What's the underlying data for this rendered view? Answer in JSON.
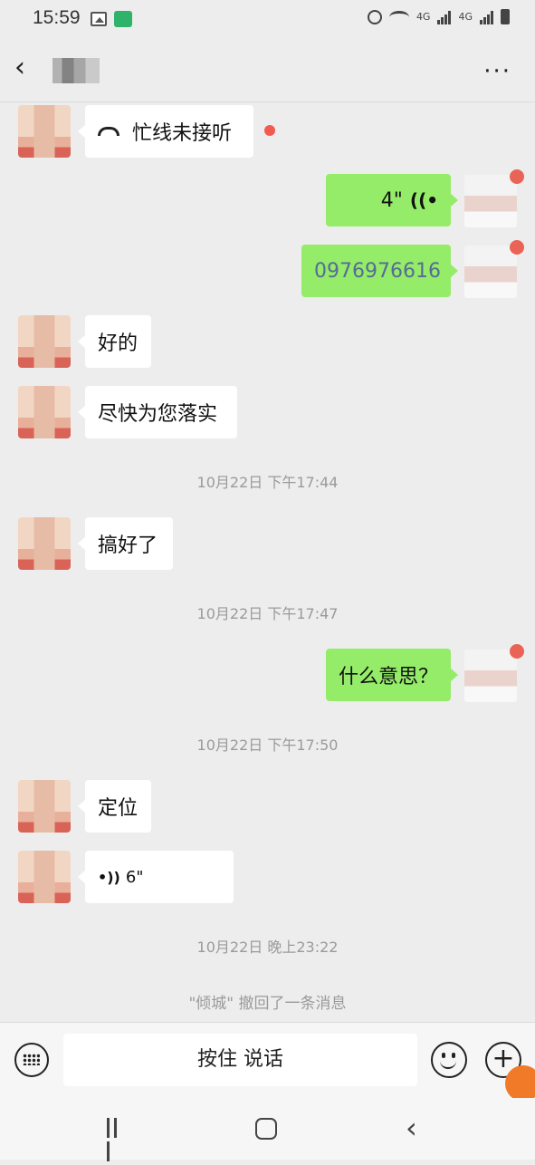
{
  "status_bar": {
    "time": "15:59",
    "network": "4G"
  },
  "header": {
    "back_symbol": "‹",
    "more_symbol": "···"
  },
  "messages": {
    "m1": {
      "text": "忙线未接听"
    },
    "m2": {
      "text": "4\"",
      "voice_symbol": "((•"
    },
    "m3": {
      "text": "0976976616"
    },
    "m4": {
      "text": "好的"
    },
    "m5": {
      "text": "尽快为您落实"
    },
    "m6": {
      "text": "搞好了"
    },
    "m7": {
      "text": "什么意思？"
    },
    "m8": {
      "text": "定位"
    },
    "m9": {
      "text": "6\"",
      "voice_symbol": "•))"
    }
  },
  "timestamps": {
    "t1": "10月22日 下午17:44",
    "t2": "10月22日 下午17:47",
    "t3": "10月22日 下午17:50",
    "t4": "10月22日 晚上23:22"
  },
  "system_notice": "\"倾城\" 撤回了一条消息",
  "input_bar": {
    "hold_to_talk": "按住 说话",
    "plus_symbol": "+"
  },
  "colors": {
    "my_bubble": "#95ec69",
    "link": "#576b95",
    "unread_dot": "#f15a50"
  }
}
